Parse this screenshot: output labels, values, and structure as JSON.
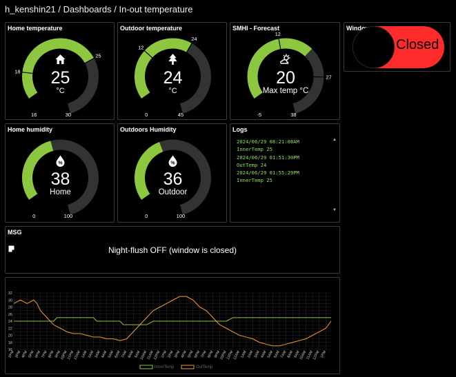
{
  "breadcrumb": "h_kenshin21 / Dashboards / In-out temperature",
  "colors": {
    "green": "#8dc63f",
    "track": "#333333",
    "red": "#ff2a2a",
    "orange": "#f39c32"
  },
  "gauges": [
    {
      "title": "Home temperature",
      "value": "25",
      "unit": "°C",
      "icon": "home-icon",
      "min": "16",
      "max": "30",
      "min_v": 16,
      "max_v": 30,
      "v": 25,
      "thresholds": [
        "18",
        "25"
      ],
      "threshold_v": [
        18,
        25
      ]
    },
    {
      "title": "Outdoor temperature",
      "value": "24",
      "unit": "°C",
      "icon": "tree-icon",
      "min": "0",
      "max": "45",
      "min_v": 0,
      "max_v": 45,
      "v": 24,
      "thresholds": [
        "12",
        "24"
      ],
      "threshold_v": [
        12,
        24
      ]
    },
    {
      "title": "SMHI - Forecast",
      "value": "20",
      "unit": "Max temp °C",
      "icon": "partly-sunny-icon",
      "min": "-5",
      "max": "38",
      "min_v": -5,
      "max_v": 38,
      "v": 20,
      "thresholds": [
        "12",
        "27"
      ],
      "threshold_v": [
        12,
        27
      ]
    },
    {
      "title": "Home humidity",
      "value": "38",
      "unit": "Home",
      "icon": "humidity-drop-icon",
      "min": "0",
      "max": "100",
      "min_v": 0,
      "max_v": 100,
      "v": 38,
      "thresholds": [],
      "threshold_v": []
    },
    {
      "title": "Outdoors Humidity",
      "value": "36",
      "unit": "Outdoor",
      "icon": "humidity-drop-icon",
      "min": "0",
      "max": "100",
      "min_v": 0,
      "max_v": 100,
      "v": 36,
      "thresholds": [],
      "threshold_v": []
    }
  ],
  "logs": {
    "title": "Logs",
    "lines": [
      "2024/06/29 08:21:08AM",
      "InnerTemp 25",
      "2024/06/29 01:51:30PM",
      "OutTemp 24",
      "2024/06/29 01:55:29PM",
      "InnerTemp 25"
    ]
  },
  "window_status": {
    "title": "Window status",
    "state": "Closed"
  },
  "msg": {
    "title": "MSG",
    "text": "Night-flush OFF (window is closed)",
    "icon": "note-icon"
  },
  "chart_data": {
    "type": "line",
    "yticks": [
      "32",
      "30",
      "28",
      "26",
      "24",
      "22",
      "20",
      "18",
      "16"
    ],
    "ylim": [
      16,
      32
    ],
    "xticks": [
      "2PM",
      "3PM",
      "4PM",
      "5PM",
      "6PM",
      "7PM",
      "8PM",
      "9PM",
      "10PM",
      "11PM",
      "12AM",
      "1AM",
      "2AM",
      "3AM",
      "4AM",
      "5AM",
      "6AM",
      "7AM",
      "8AM",
      "9AM",
      "10AM",
      "11AM",
      "12PM",
      "1PM",
      "2PM",
      "3PM",
      "4PM",
      "5PM",
      "6PM",
      "7PM",
      "8PM",
      "9PM",
      "10PM",
      "11PM",
      "12AM",
      "1AM",
      "2AM",
      "3AM",
      "4AM",
      "5AM",
      "6AM",
      "7AM",
      "8AM",
      "9AM",
      "10AM",
      "11AM",
      "12PM",
      "1PM"
    ],
    "series": [
      {
        "name": "InnerTemp",
        "color": "#8dc63f",
        "x": [
          0,
          6,
          6.5,
          12,
          12.5,
          16,
          16.5,
          20,
          21,
          28,
          28.5,
          32,
          33,
          38,
          38.5,
          47.8
        ],
        "y": [
          24,
          24,
          25,
          25,
          24,
          24,
          23,
          23,
          24,
          24,
          24,
          24,
          25,
          25,
          25,
          25
        ]
      },
      {
        "name": "OutTemp",
        "color": "#f39c32",
        "x": [
          0,
          1,
          2,
          3,
          3.5,
          4,
          5,
          6,
          7,
          8,
          9,
          10,
          11,
          12,
          13,
          14,
          15,
          16,
          17,
          18,
          19,
          20,
          21,
          22,
          23,
          24,
          25,
          26,
          27,
          28,
          29,
          30,
          31,
          32,
          33,
          34,
          35,
          36,
          37,
          38,
          39,
          40,
          41,
          42,
          43,
          44,
          45,
          46,
          47,
          47.8
        ],
        "y": [
          29,
          30,
          29,
          30,
          29,
          27,
          25,
          23,
          22,
          21,
          20.5,
          20.5,
          20,
          19.5,
          19.5,
          19,
          19,
          18.5,
          19,
          21,
          23,
          25,
          27,
          28,
          29,
          30,
          31,
          31,
          30,
          28,
          27,
          25,
          23,
          22,
          21,
          20,
          19.5,
          19,
          18,
          17.5,
          17,
          17,
          17.5,
          18,
          18.5,
          19,
          20,
          21,
          22,
          24
        ]
      }
    ]
  }
}
